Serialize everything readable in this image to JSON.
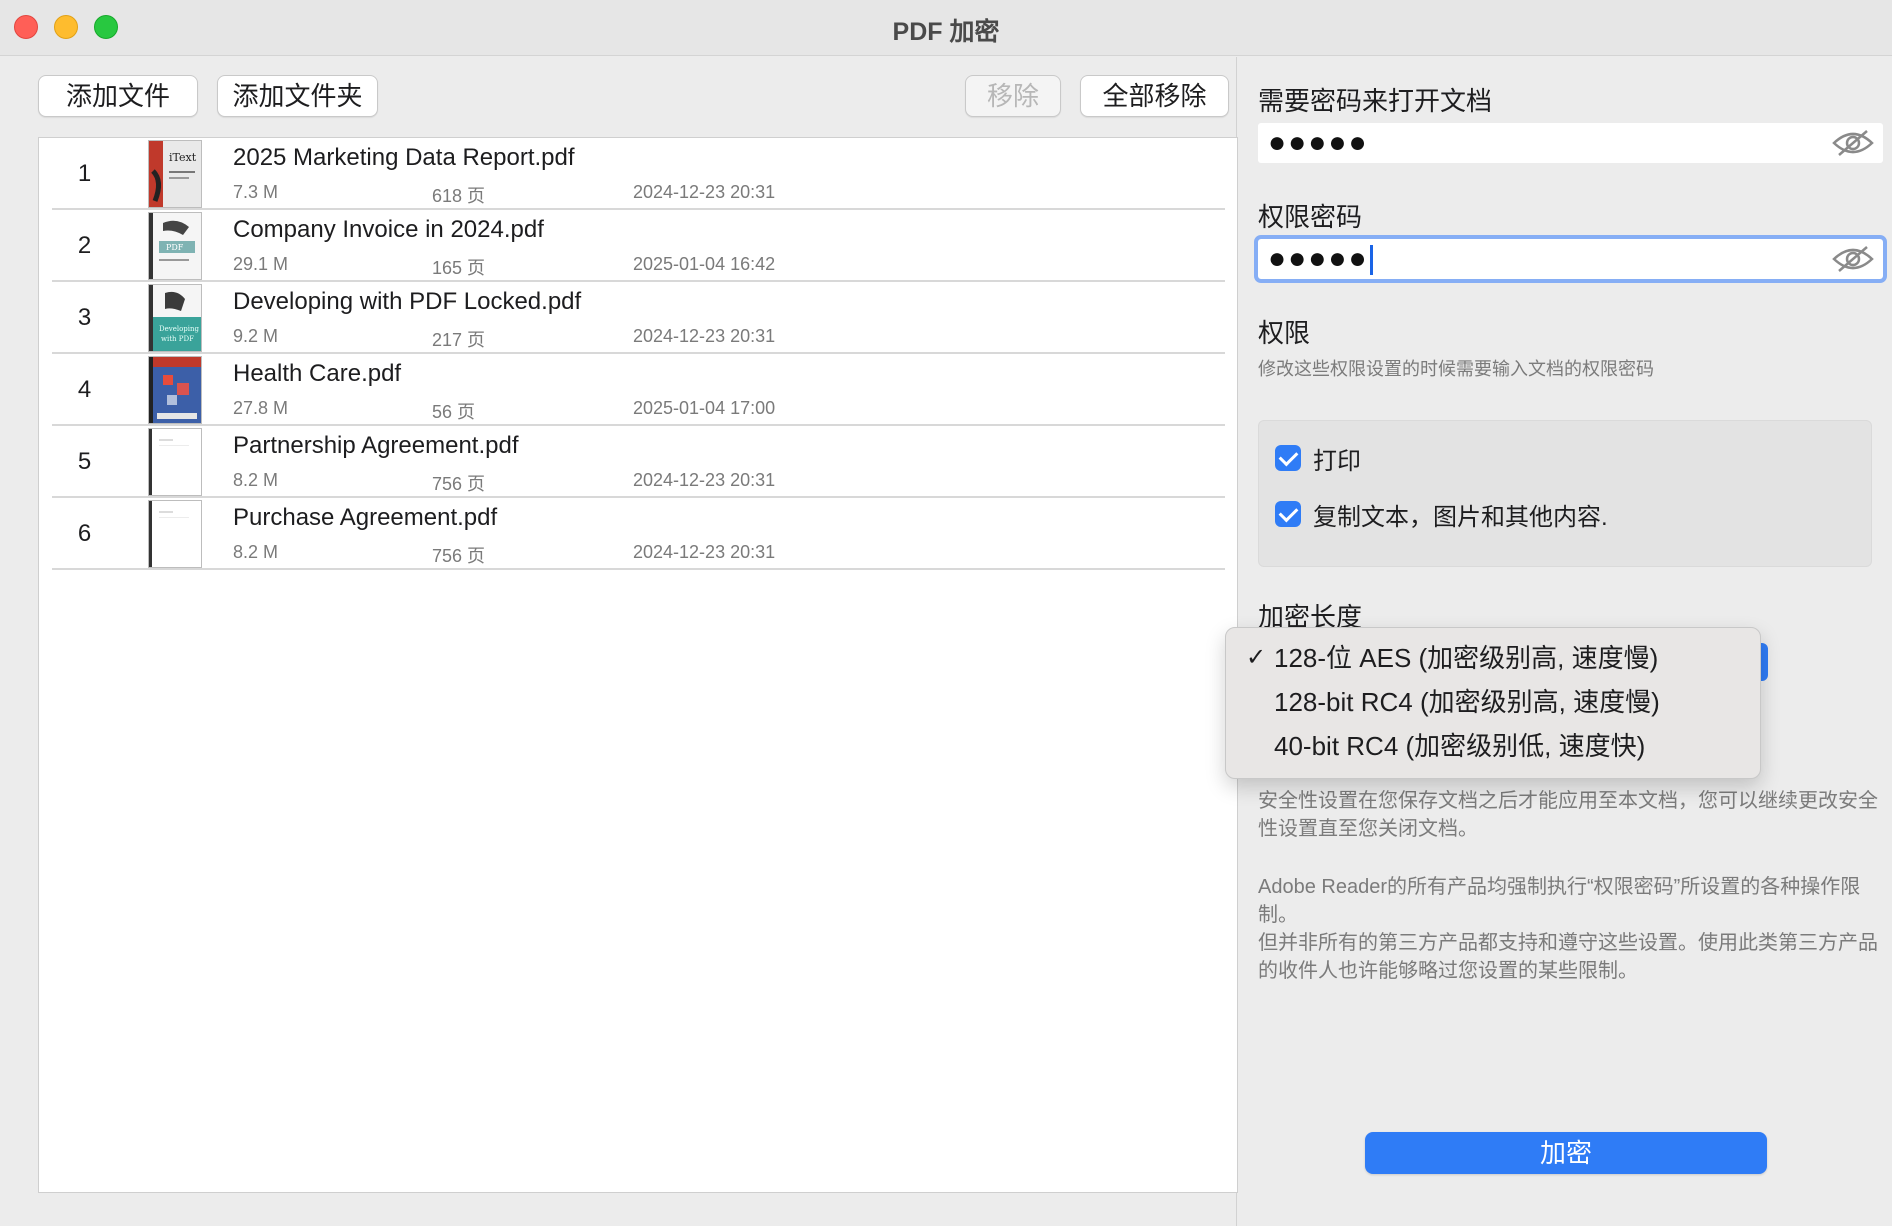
{
  "window": {
    "title": "PDF 加密"
  },
  "toolbar": {
    "add_file": "添加文件",
    "add_folder": "添加文件夹",
    "remove": "移除",
    "remove_all": "全部移除"
  },
  "files": [
    {
      "index": "1",
      "name": "2025 Marketing Data Report.pdf",
      "size": "7.3 M",
      "pages": "618 页",
      "date": "2024-12-23 20:31",
      "thumb": "itext-book"
    },
    {
      "index": "2",
      "name": "Company Invoice in 2024.pdf",
      "size": "29.1 M",
      "pages": "165 页",
      "date": "2025-01-04 16:42",
      "thumb": "pdf-book"
    },
    {
      "index": "3",
      "name": "Developing with PDF Locked.pdf",
      "size": "9.2 M",
      "pages": "217 页",
      "date": "2024-12-23 20:31",
      "thumb": "developing-pdf-book"
    },
    {
      "index": "4",
      "name": "Health Care.pdf",
      "size": "27.8 M",
      "pages": "56 页",
      "date": "2025-01-04 17:00",
      "thumb": "red-blue-cover"
    },
    {
      "index": "5",
      "name": "Partnership Agreement.pdf",
      "size": "8.2 M",
      "pages": "756 页",
      "date": "2024-12-23 20:31",
      "thumb": "blank-document"
    },
    {
      "index": "6",
      "name": "Purchase Agreement.pdf",
      "size": "8.2 M",
      "pages": "756 页",
      "date": "2024-12-23 20:31",
      "thumb": "blank-document"
    }
  ],
  "open_password": {
    "label": "需要密码来打开文档",
    "value": "●●●●●",
    "icon": "eye-slash-icon"
  },
  "permission_password": {
    "label": "权限密码",
    "value": "●●●●●",
    "icon": "eye-slash-icon"
  },
  "permissions": {
    "label": "权限",
    "hint": "修改这些权限设置的时候需要输入文档的权限密码",
    "print": {
      "label": "打印",
      "checked": true
    },
    "copy": {
      "label": "复制文本，图片和其他内容.",
      "checked": true
    }
  },
  "encryption": {
    "label": "加密长度",
    "options": [
      {
        "label": "128-位 AES (加密级别高, 速度慢)",
        "selected": true,
        "checkmark": "✓"
      },
      {
        "label": "128-bit RC4 (加密级别高, 速度慢)",
        "selected": false,
        "checkmark": ""
      },
      {
        "label": "40-bit RC4 (加密级别低, 速度快)",
        "selected": false,
        "checkmark": ""
      }
    ]
  },
  "notes": {
    "security": "安全性设置在您保存文档之后才能应用至本文档，您可以继续更改安全性设置直至您关闭文档。",
    "adobe_1": "Adobe Reader的所有产品均强制执行“权限密码”所设置的各种操作限制。",
    "adobe_2": "但并非所有的第三方产品都支持和遵守这些设置。使用此类第三方产品的收件人也许能够略过您设置的某些限制。"
  },
  "encrypt_button": "加密",
  "colors": {
    "accent": "#2f7cf6",
    "focus_ring": "#86aef5",
    "close": "#ff5f57",
    "minimize": "#febc2e",
    "zoom": "#28c840"
  }
}
